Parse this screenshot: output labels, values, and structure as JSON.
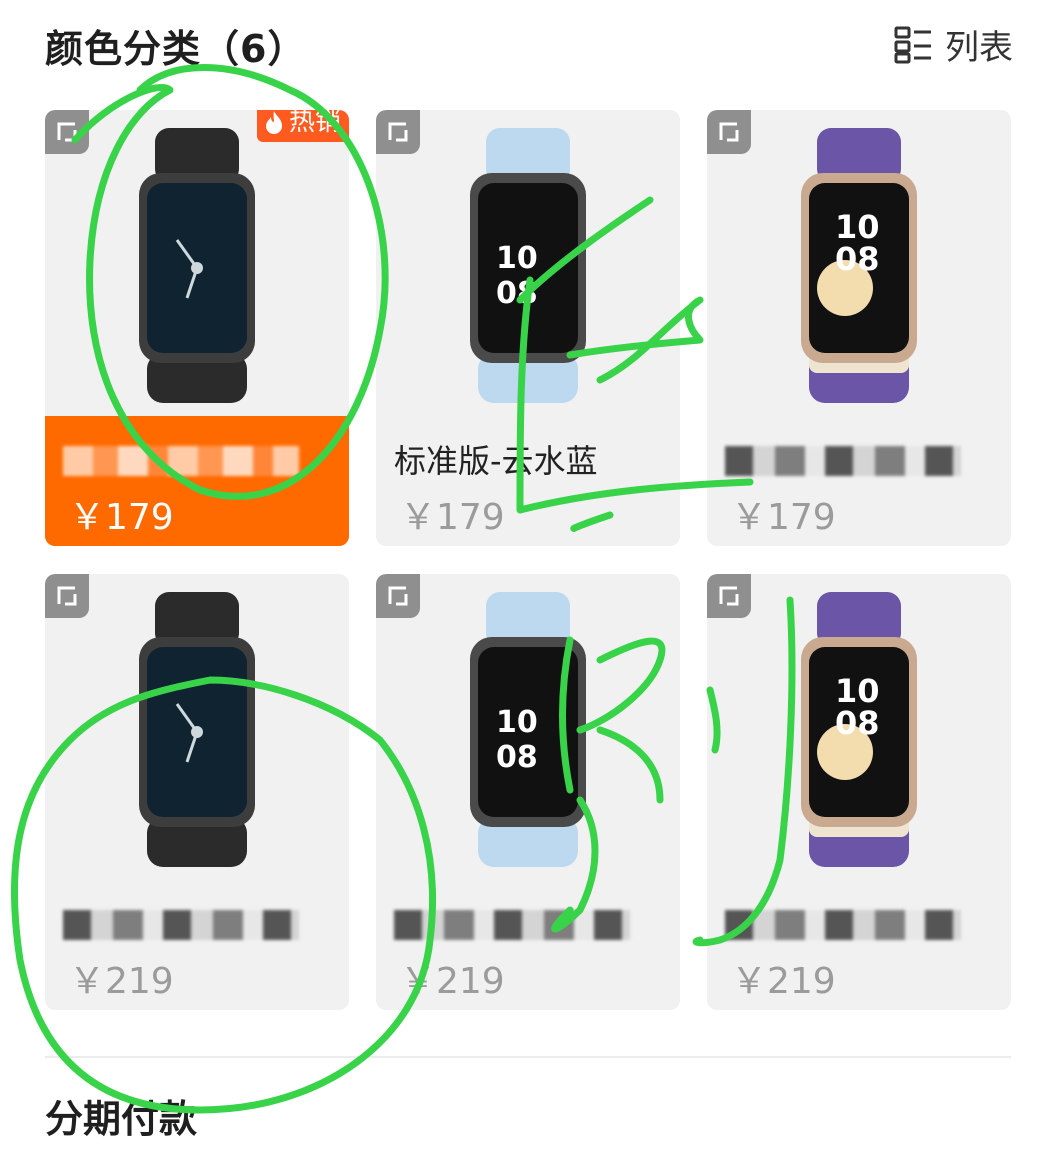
{
  "header": {
    "title": "颜色分类（6）",
    "view_toggle_label": "列表",
    "view_toggle_icon": "list-view-icon"
  },
  "badge": {
    "hot_label": "热销",
    "hot_icon": "flame-icon"
  },
  "colors": {
    "accent": "#ff6a00",
    "card_bg": "#f1f1f1",
    "annotation": "#39d34a"
  },
  "products": [
    {
      "name": "",
      "price": "￥179",
      "selected": true,
      "hot": true,
      "strap": "black"
    },
    {
      "name": "标准版-云水蓝",
      "price": "￥179",
      "selected": false,
      "hot": false,
      "strap": "blue"
    },
    {
      "name": "",
      "price": "￥179",
      "selected": false,
      "hot": false,
      "strap": "purple"
    },
    {
      "name": "",
      "price": "￥219",
      "selected": false,
      "hot": false,
      "strap": "black"
    },
    {
      "name": "",
      "price": "￥219",
      "selected": false,
      "hot": false,
      "strap": "blue"
    },
    {
      "name": "",
      "price": "￥219",
      "selected": false,
      "hot": false,
      "strap": "purple"
    }
  ],
  "section2": {
    "title": "分期付款"
  }
}
